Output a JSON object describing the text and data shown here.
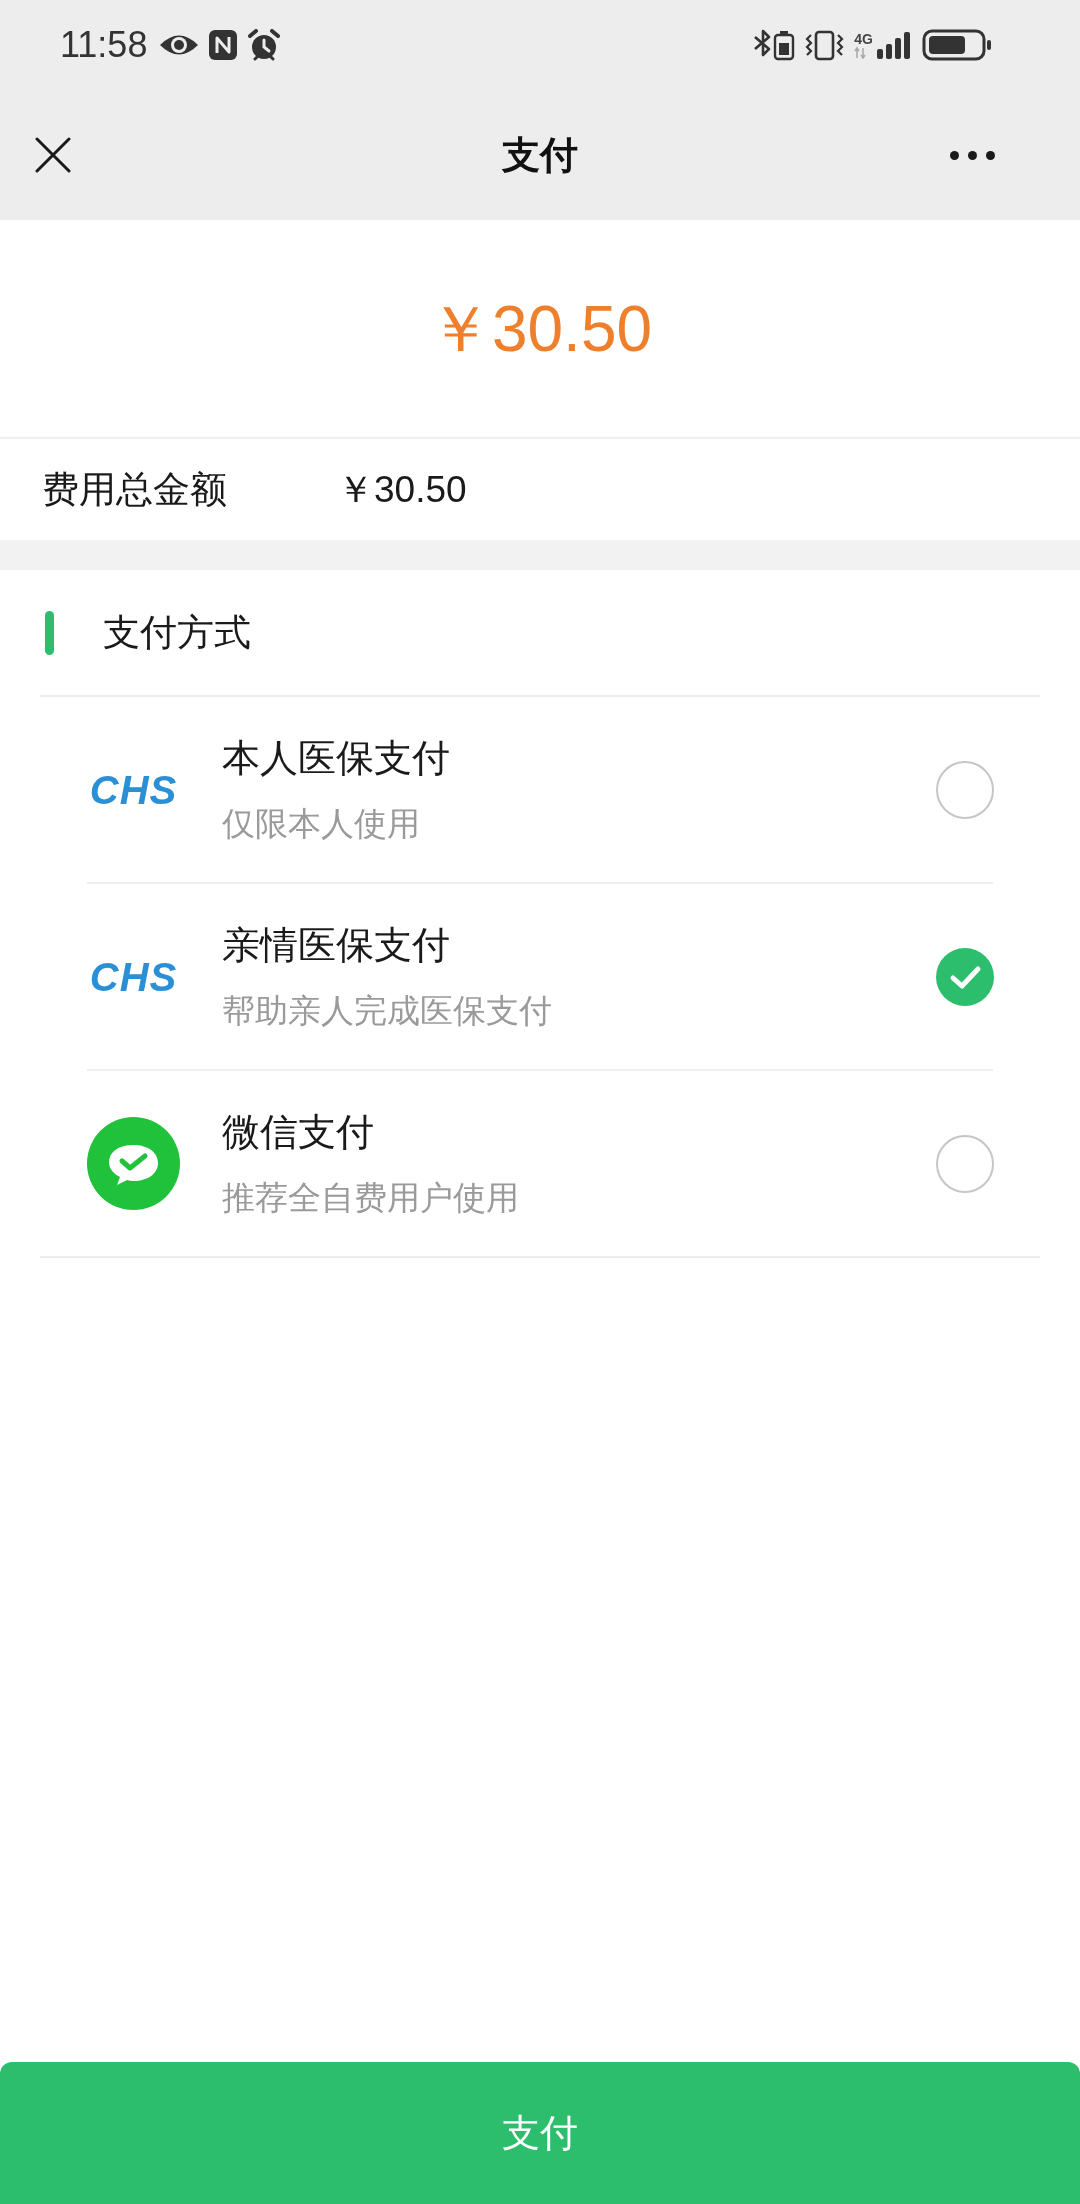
{
  "status_bar": {
    "time": "11:58",
    "network": "4G"
  },
  "nav_bar": {
    "title": "支付"
  },
  "amount": {
    "value": "￥30.50"
  },
  "summary": {
    "label": "费用总金额",
    "value": "￥30.50"
  },
  "payment_section": {
    "title": "支付方式",
    "methods": [
      {
        "kind": "text_logo",
        "logo_text": "CHS",
        "title": "本人医保支付",
        "subtitle": "仅限本人使用",
        "selected": false
      },
      {
        "kind": "text_logo",
        "logo_text": "CHS",
        "title": "亲情医保支付",
        "subtitle": "帮助亲人完成医保支付",
        "selected": true
      },
      {
        "kind": "chat_logo",
        "title": "微信支付",
        "subtitle": "推荐全自费用户使用",
        "selected": false
      }
    ]
  },
  "pay_button": {
    "label": "支付"
  }
}
